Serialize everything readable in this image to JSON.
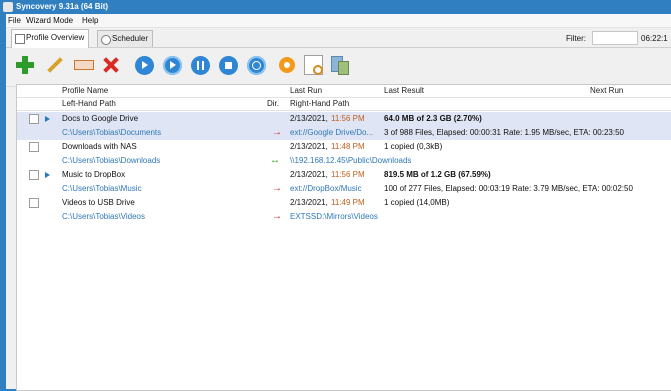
{
  "title": "Syncovery 9.31a (64 Bit)",
  "menu": [
    "File",
    "Wizard Mode",
    "Help"
  ],
  "tabs": [
    {
      "label": "Profile Overview",
      "icon": "profile-icon"
    },
    {
      "label": "Scheduler",
      "icon": "scheduler-icon"
    }
  ],
  "filter": {
    "label": "Filter:",
    "value": ""
  },
  "clock": "06:22:1",
  "toolbar": [
    {
      "name": "new-profile",
      "icon": "plus-icon"
    },
    {
      "name": "edit-profile",
      "icon": "pencil-icon"
    },
    {
      "name": "rename-profile",
      "icon": "rename-icon"
    },
    {
      "name": "delete-profile",
      "icon": "delete-icon"
    },
    {
      "name": "run",
      "icon": "play-icon"
    },
    {
      "name": "run-attended",
      "icon": "play-outline-icon"
    },
    {
      "name": "pause",
      "icon": "pause-icon"
    },
    {
      "name": "stop",
      "icon": "stop-icon"
    },
    {
      "name": "refresh",
      "icon": "circle-icon"
    },
    {
      "name": "settings",
      "icon": "gear-icon"
    },
    {
      "name": "search-logs",
      "icon": "search-doc-icon"
    },
    {
      "name": "database",
      "icon": "database-icon"
    }
  ],
  "headers": {
    "profile_name": "Profile Name",
    "last_run": "Last Run",
    "last_result": "Last Result",
    "next_run": "Next Run",
    "left_path": "Left-Hand Path",
    "dir": "Dir.",
    "right_path": "Right-Hand Path"
  },
  "profiles": [
    {
      "name": "Docs to Google Drive",
      "date": "2/13/2021,",
      "time": "11:56 PM",
      "result": "64.0 MB of 2.3 GB (2.70%)",
      "left": "C:\\Users\\Tobias\\Documents",
      "dir": "→",
      "right": "ext://Google Drive/Do...",
      "details": "3 of 988 Files, Elapsed: 00:00:31  Rate: 1.95 MB/sec, ETA: 00:23:50",
      "selected": true,
      "playing": true,
      "result_bold": true
    },
    {
      "name": "Downloads with NAS",
      "date": "2/13/2021,",
      "time": "11:48 PM",
      "result": "1 copied (0,3kB)",
      "left": "C:\\Users\\Tobias\\Downloads",
      "dir": "↔",
      "right": "\\\\192.168.12.45\\Public\\Downloads",
      "details": "",
      "selected": false,
      "playing": false,
      "result_bold": false
    },
    {
      "name": "Music to DropBox",
      "date": "2/13/2021,",
      "time": "11:56 PM",
      "result": "819.5 MB of 1.2 GB (67.59%)",
      "left": "C:\\Users\\Tobias\\Music",
      "dir": "→",
      "right": "ext://DropBox/Music",
      "details": "100 of 277 Files, Elapsed: 00:03:19  Rate: 3.79 MB/sec, ETA: 00:02:50",
      "selected": false,
      "playing": true,
      "result_bold": true
    },
    {
      "name": "Videos to USB Drive",
      "date": "2/13/2021,",
      "time": "11:49 PM",
      "result": "1 copied (14,0MB)",
      "left": "C:\\Users\\Tobias\\Videos",
      "dir": "→",
      "right": "EXTSSD:\\Mirrors\\Videos",
      "details": "",
      "selected": false,
      "playing": false,
      "result_bold": false
    }
  ]
}
